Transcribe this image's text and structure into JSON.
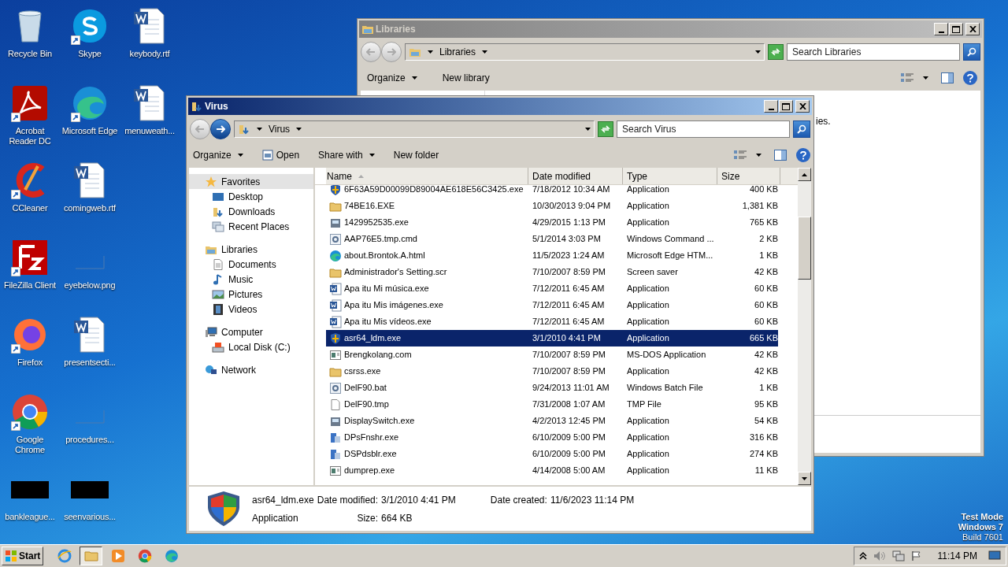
{
  "desktop_icons": [
    {
      "label": "Recycle Bin",
      "kind": "recycle",
      "shortcut": false
    },
    {
      "label": "Acrobat Reader DC",
      "kind": "pdf",
      "shortcut": true
    },
    {
      "label": "CCleaner",
      "kind": "ccleaner",
      "shortcut": true
    },
    {
      "label": "FileZilla Client",
      "kind": "filezilla",
      "shortcut": true
    },
    {
      "label": "Firefox",
      "kind": "firefox",
      "shortcut": true
    },
    {
      "label": "Google Chrome",
      "kind": "chrome",
      "shortcut": true
    },
    {
      "label": "bankleague...",
      "kind": "dark",
      "shortcut": false
    },
    {
      "label": "Skype",
      "kind": "skype",
      "shortcut": true
    },
    {
      "label": "Microsoft Edge",
      "kind": "edge",
      "shortcut": true
    },
    {
      "label": "comingweb.rtf",
      "kind": "word",
      "shortcut": false
    },
    {
      "label": "eyebelow.png",
      "kind": "blank",
      "shortcut": false
    },
    {
      "label": "presentsecti...",
      "kind": "word",
      "shortcut": false
    },
    {
      "label": "procedures...",
      "kind": "blank",
      "shortcut": false
    },
    {
      "label": "seenvarious...",
      "kind": "dark",
      "shortcut": false
    },
    {
      "label": "keybody.rtf",
      "kind": "word",
      "shortcut": false
    },
    {
      "label": "menuweath...",
      "kind": "word",
      "shortcut": false
    }
  ],
  "back_window": {
    "title": "Libraries",
    "breadcrumb": "Libraries",
    "search_placeholder": "Search Libraries",
    "toolbar": [
      "Organize",
      "New library"
    ],
    "fragment": "ies."
  },
  "window": {
    "title": "Virus",
    "breadcrumb": "Virus",
    "search_placeholder": "Search Virus",
    "toolbar": [
      {
        "label": "Organize",
        "kind": "menu"
      },
      {
        "label": "Open",
        "kind": "open"
      },
      {
        "label": "Share with",
        "kind": "menu"
      },
      {
        "label": "New folder",
        "kind": "plain"
      }
    ],
    "nav": [
      {
        "label": "Favorites",
        "selected": true,
        "children": [
          {
            "label": "Desktop",
            "selected": false
          },
          {
            "label": "Downloads",
            "selected": false
          },
          {
            "label": "Recent Places",
            "selected": false
          }
        ]
      },
      {
        "label": "Libraries",
        "selected": false,
        "children": [
          {
            "label": "Documents",
            "selected": false
          },
          {
            "label": "Music",
            "selected": false
          },
          {
            "label": "Pictures",
            "selected": false
          },
          {
            "label": "Videos",
            "selected": false
          }
        ]
      },
      {
        "label": "Computer",
        "selected": false,
        "children": [
          {
            "label": "Local Disk (C:)",
            "selected": false
          }
        ]
      },
      {
        "label": "Network",
        "selected": false
      }
    ],
    "columns": [
      "Name",
      "Date modified",
      "Type",
      "Size"
    ],
    "rows": [
      {
        "name": "6F63A59D00099D89004AE618E56C3425.exe",
        "date": "7/18/2012 10:34 AM",
        "type": "Application",
        "size": "400 KB",
        "kind": "shield",
        "selected": false
      },
      {
        "name": "74BE16.EXE",
        "date": "10/30/2013 9:04 PM",
        "type": "Application",
        "size": "1,381 KB",
        "kind": "folder",
        "selected": false
      },
      {
        "name": "1429952535.exe",
        "date": "4/29/2015 1:13 PM",
        "type": "Application",
        "size": "765 KB",
        "kind": "app",
        "selected": false
      },
      {
        "name": "AAP76E5.tmp.cmd",
        "date": "5/1/2014 3:03 PM",
        "type": "Windows Command ...",
        "size": "2 KB",
        "kind": "gear",
        "selected": false
      },
      {
        "name": "about.Brontok.A.html",
        "date": "11/5/2023 1:24 AM",
        "type": "Microsoft Edge HTM...",
        "size": "1 KB",
        "kind": "edge",
        "selected": false
      },
      {
        "name": "Administrador's Setting.scr",
        "date": "7/10/2007 8:59 PM",
        "type": "Screen saver",
        "size": "42 KB",
        "kind": "folder",
        "selected": false
      },
      {
        "name": "Apa itu Mi música.exe",
        "date": "7/12/2011 6:45 AM",
        "type": "Application",
        "size": "60 KB",
        "kind": "word",
        "selected": false
      },
      {
        "name": "Apa itu Mis imágenes.exe",
        "date": "7/12/2011 6:45 AM",
        "type": "Application",
        "size": "60 KB",
        "kind": "word",
        "selected": false
      },
      {
        "name": "Apa itu Mis vídeos.exe",
        "date": "7/12/2011 6:45 AM",
        "type": "Application",
        "size": "60 KB",
        "kind": "word",
        "selected": false
      },
      {
        "name": "asr64_ldm.exe",
        "date": "3/1/2010 4:41 PM",
        "type": "Application",
        "size": "665 KB",
        "kind": "shield",
        "selected": true
      },
      {
        "name": "Brengkolang.com",
        "date": "7/10/2007 8:59 PM",
        "type": "MS-DOS Application",
        "size": "42 KB",
        "kind": "window",
        "selected": false
      },
      {
        "name": "csrss.exe",
        "date": "7/10/2007 8:59 PM",
        "type": "Application",
        "size": "42 KB",
        "kind": "folder",
        "selected": false
      },
      {
        "name": "DelF90.bat",
        "date": "9/24/2013 11:01 AM",
        "type": "Windows Batch File",
        "size": "1 KB",
        "kind": "gear",
        "selected": false
      },
      {
        "name": "DelF90.tmp",
        "date": "7/31/2008 1:07 AM",
        "type": "TMP File",
        "size": "95 KB",
        "kind": "blank",
        "selected": false
      },
      {
        "name": "DisplaySwitch.exe",
        "date": "4/2/2013 12:45 PM",
        "type": "Application",
        "size": "54 KB",
        "kind": "app",
        "selected": false
      },
      {
        "name": "DPsFnshr.exe",
        "date": "6/10/2009 5:00 PM",
        "type": "Application",
        "size": "316 KB",
        "kind": "installer",
        "selected": false
      },
      {
        "name": "DSPdsblr.exe",
        "date": "6/10/2009 5:00 PM",
        "type": "Application",
        "size": "274 KB",
        "kind": "installer",
        "selected": false
      },
      {
        "name": "dumprep.exe",
        "date": "4/14/2008 5:00 AM",
        "type": "Application",
        "size": "11 KB",
        "kind": "window",
        "selected": false
      }
    ],
    "details": {
      "name": "asr64_ldm.exe",
      "type": "Application",
      "fields": [
        {
          "label": "Date modified:",
          "value": "3/1/2010 4:41 PM"
        },
        {
          "label": "Size:",
          "value": "664 KB"
        },
        {
          "label": "Date created:",
          "value": "11/6/2023 11:14 PM"
        }
      ]
    }
  },
  "os_notice": [
    "Test Mode",
    "Windows 7",
    "Build 7601"
  ],
  "taskbar": {
    "start": "Start",
    "apps": [
      {
        "kind": "ie",
        "selected": false
      },
      {
        "kind": "explorer",
        "selected": true
      },
      {
        "kind": "media",
        "selected": false
      },
      {
        "kind": "chrome",
        "selected": false
      },
      {
        "kind": "edge",
        "selected": false
      }
    ],
    "clock": "11:14 PM"
  }
}
